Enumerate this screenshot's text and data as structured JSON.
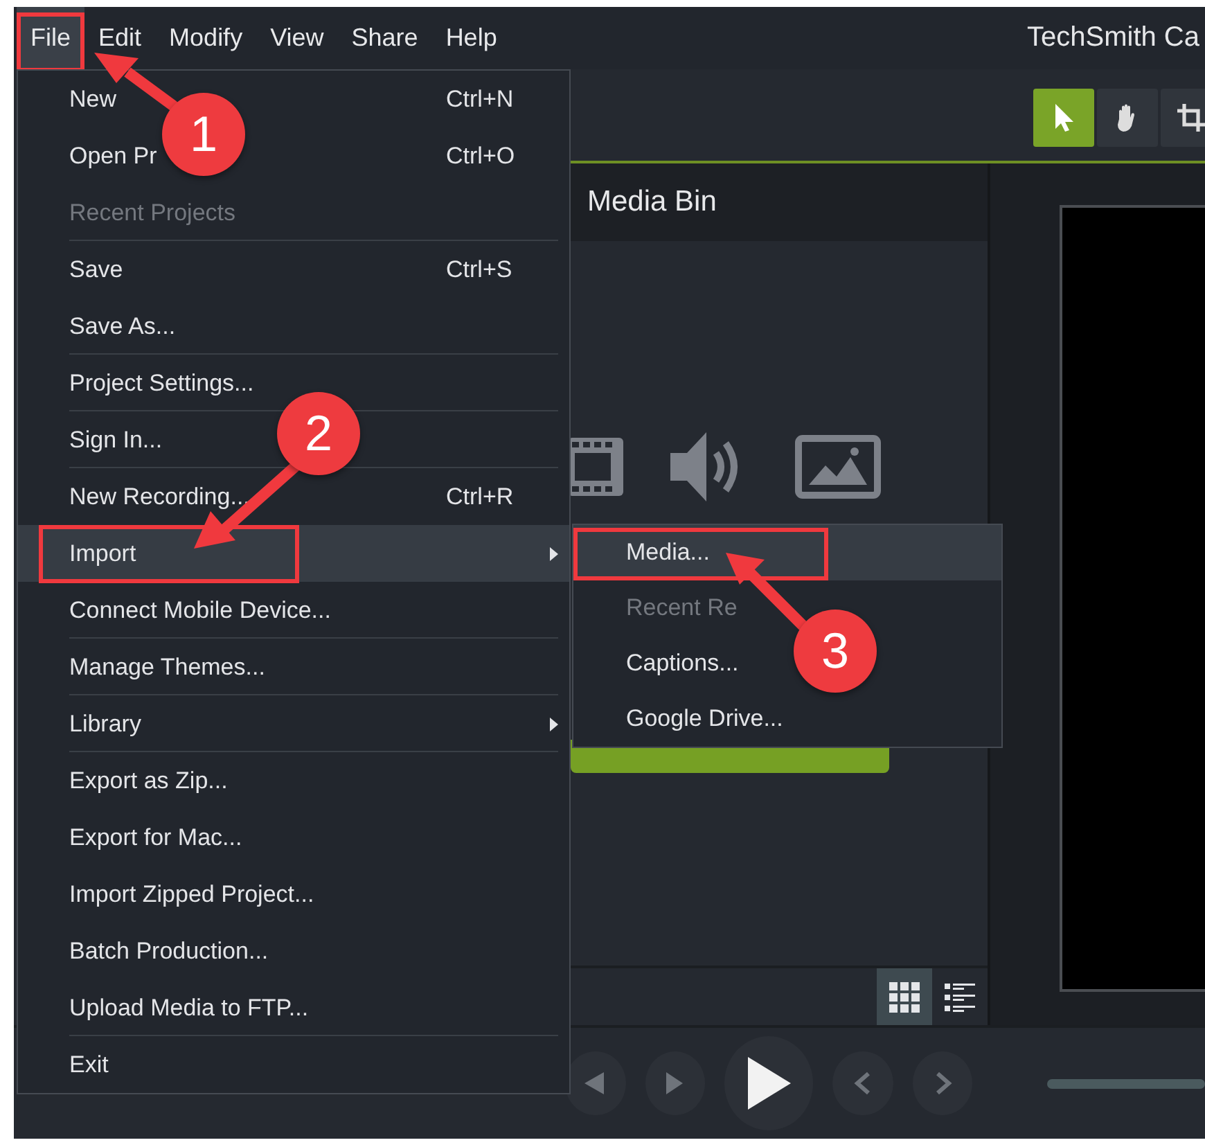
{
  "menubar": {
    "menus": [
      {
        "label": "File",
        "selected": true,
        "outlined": true
      },
      {
        "label": "Edit",
        "selected": false,
        "outlined": false
      },
      {
        "label": "Modify",
        "selected": false,
        "outlined": false
      },
      {
        "label": "View",
        "selected": false,
        "outlined": false
      },
      {
        "label": "Share",
        "selected": false,
        "outlined": false
      },
      {
        "label": "Help",
        "selected": false,
        "outlined": false
      }
    ],
    "title": "TechSmith Ca"
  },
  "tools": [
    {
      "kind": "select",
      "selected": true
    },
    {
      "kind": "pan",
      "selected": false
    },
    {
      "kind": "crop",
      "selected": false
    }
  ],
  "media_bin": {
    "title": "Media Bin",
    "view_buttons": [
      {
        "kind": "grid",
        "selected": true
      },
      {
        "kind": "list",
        "selected": false
      }
    ]
  },
  "file_menu": {
    "items": [
      {
        "label": "New",
        "shortcut": "Ctrl+N",
        "disabled": false,
        "submenu": false,
        "selected": false,
        "outlined": false,
        "divider": false
      },
      {
        "label": "Open Pr",
        "shortcut": "Ctrl+O",
        "disabled": false,
        "submenu": false,
        "selected": false,
        "outlined": false,
        "divider": false
      },
      {
        "label": "Recent Projects",
        "disabled": true,
        "submenu": false,
        "selected": false,
        "outlined": false,
        "divider": true
      },
      {
        "label": "Save",
        "shortcut": "Ctrl+S",
        "disabled": false,
        "submenu": false,
        "selected": false,
        "outlined": false,
        "divider": false
      },
      {
        "label": "Save As...",
        "disabled": false,
        "submenu": false,
        "selected": false,
        "outlined": false,
        "divider": true
      },
      {
        "label": "Project Settings...",
        "disabled": false,
        "submenu": false,
        "selected": false,
        "outlined": false,
        "divider": true
      },
      {
        "label": "Sign In...",
        "disabled": false,
        "submenu": false,
        "selected": false,
        "outlined": false,
        "divider": true
      },
      {
        "label": "New Recording...",
        "shortcut": "Ctrl+R",
        "disabled": false,
        "submenu": false,
        "selected": false,
        "outlined": false,
        "divider": false
      },
      {
        "label": "Import",
        "disabled": false,
        "submenu": true,
        "selected": true,
        "outlined": true,
        "divider": false
      },
      {
        "label": "Connect Mobile Device...",
        "disabled": false,
        "submenu": false,
        "selected": false,
        "outlined": false,
        "divider": true
      },
      {
        "label": "Manage Themes...",
        "disabled": false,
        "submenu": false,
        "selected": false,
        "outlined": false,
        "divider": true
      },
      {
        "label": "Library",
        "disabled": false,
        "submenu": true,
        "selected": false,
        "outlined": false,
        "divider": true
      },
      {
        "label": "Export as Zip...",
        "disabled": false,
        "submenu": false,
        "selected": false,
        "outlined": false,
        "divider": false
      },
      {
        "label": "Export for Mac...",
        "disabled": false,
        "submenu": false,
        "selected": false,
        "outlined": false,
        "divider": false
      },
      {
        "label": "Import Zipped Project...",
        "disabled": false,
        "submenu": false,
        "selected": false,
        "outlined": false,
        "divider": false
      },
      {
        "label": "Batch Production...",
        "disabled": false,
        "submenu": false,
        "selected": false,
        "outlined": false,
        "divider": false
      },
      {
        "label": "Upload Media to FTP...",
        "disabled": false,
        "submenu": false,
        "selected": false,
        "outlined": false,
        "divider": true
      },
      {
        "label": "Exit",
        "disabled": false,
        "submenu": false,
        "selected": false,
        "outlined": false,
        "divider": false
      }
    ]
  },
  "import_submenu": {
    "items": [
      {
        "label": "Media...",
        "disabled": false,
        "selected": true,
        "outlined": true
      },
      {
        "label": "Recent Re",
        "disabled": true,
        "selected": false,
        "outlined": false
      },
      {
        "label": "Captions...",
        "disabled": false,
        "selected": false,
        "outlined": false
      },
      {
        "label": "Google Drive...",
        "disabled": false,
        "selected": false,
        "outlined": false
      }
    ]
  },
  "annotations": [
    {
      "number": "1"
    },
    {
      "number": "2"
    },
    {
      "number": "3"
    }
  ]
}
